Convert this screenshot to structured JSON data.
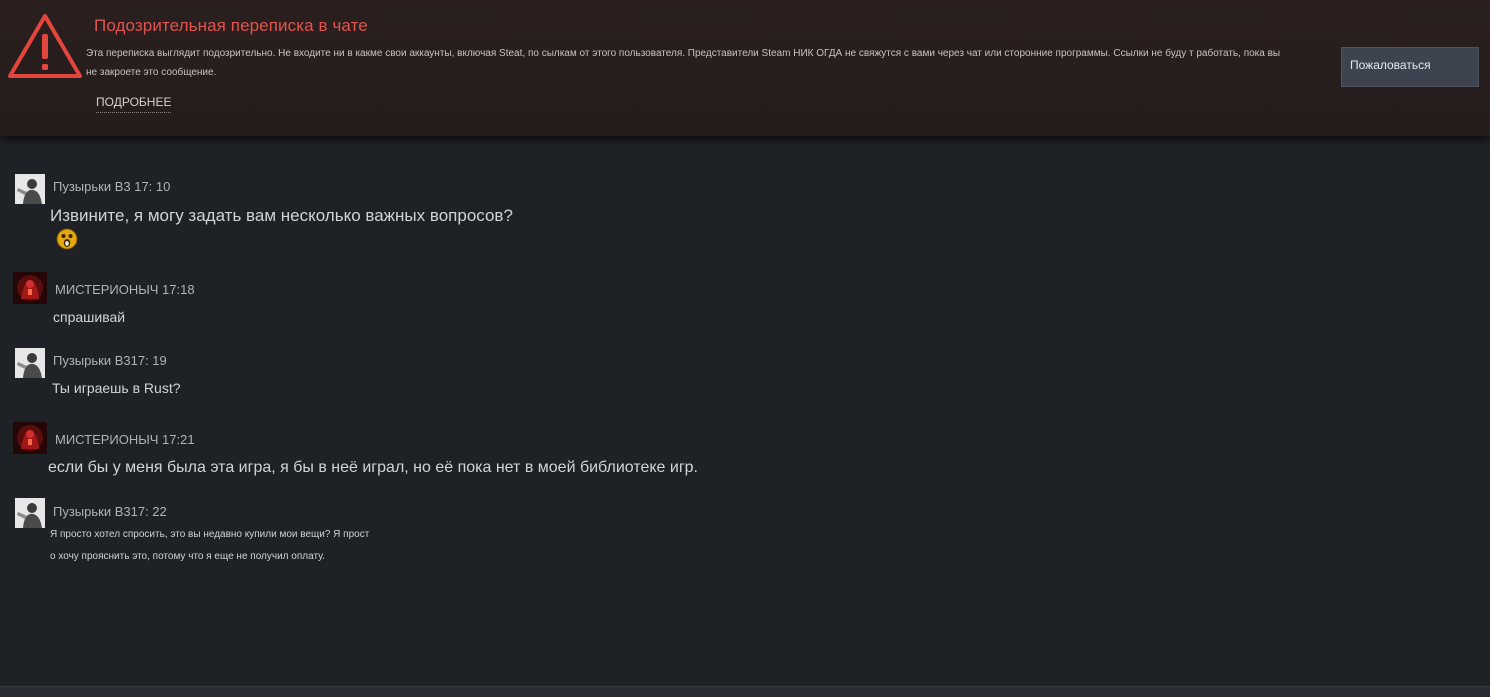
{
  "warning": {
    "title": "Подозрительная переписка в чате",
    "text": "Эта переписка выглядит подозрительно. Не входите ни в какме свои аккаунты, включая Steat, по сылкам от этого пользователя. Представители Steam НИК ОГДА не свяжутся с вами через чат или сторонние программы. Ссылки не буду т работать, пока вы не закроете это сообщение.",
    "more_label": "ПОДРОБНЕЕ",
    "report_label": "Пожаловаться",
    "icon": "warning-triangle-icon",
    "accent_color": "#e0544d"
  },
  "messages": [
    {
      "header": "Пузырьки B3 17: 10",
      "lines": [
        "Извините, я могу задать вам несколько важных вопросов?"
      ],
      "emoticon": "surprised-emoticon-icon"
    },
    {
      "header": "МИСТЕРИОНЫЧ 17:18",
      "lines": [
        "спрашивай"
      ]
    },
    {
      "header": "Пузырьки B317: 19",
      "lines": [
        "Ты играешь в Rust?"
      ]
    },
    {
      "header": "МИСТЕРИОНЫЧ 17:21",
      "lines": [
        "если бы у меня была эта игра, я бы в неё играл, но её пока нет в моей библиотеке игр."
      ]
    },
    {
      "header": "Пузырьки B317: 22",
      "lines": [
        "Я просто хотел спросить, это вы недавно купили мои вещи? Я прост",
        "о хочу прояснить это, потому что я еще не получил оплату."
      ]
    }
  ]
}
